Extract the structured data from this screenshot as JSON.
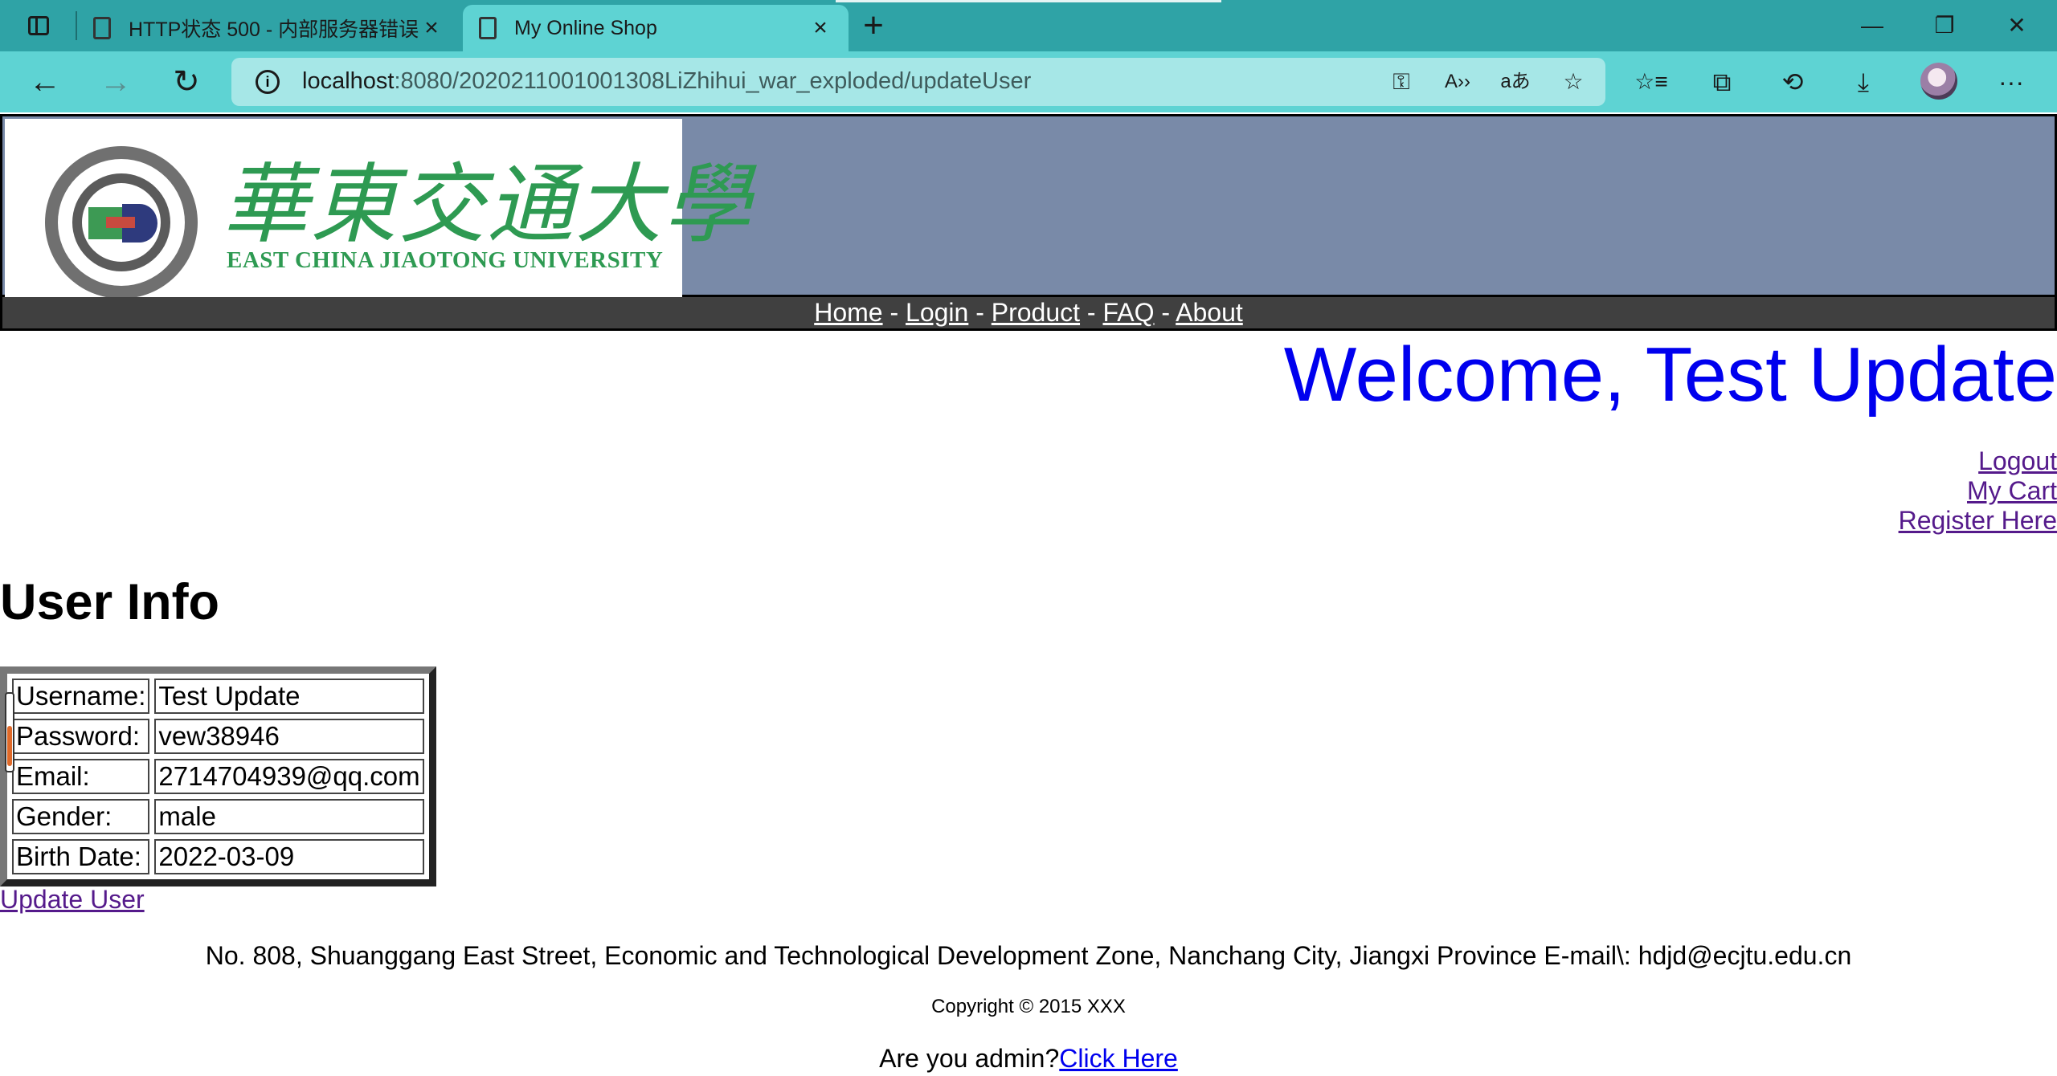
{
  "browser": {
    "tabs": [
      {
        "title": "HTTP状态 500 - 内部服务器错误",
        "active": false
      },
      {
        "title": "My Online Shop",
        "active": true
      }
    ],
    "new_tab": "+",
    "window_controls": {
      "minimize": "—",
      "restore": "❐",
      "close": "✕"
    },
    "nav": {
      "back": "←",
      "forward": "→",
      "refresh": "↻"
    },
    "address": {
      "host": "localhost",
      "rest": ":8080/2020211001001308LiZhihui_war_exploded/updateUser"
    },
    "address_icons": [
      "key-icon",
      "read-aloud-icon",
      "translate-icon",
      "add-favorite-icon"
    ],
    "toolbar_icons": [
      "favorites-icon",
      "collections-icon",
      "history-icon",
      "downloads-icon",
      "profile-avatar",
      "more-icon"
    ],
    "icon_glyphs": {
      "key": "⚿",
      "read_aloud": "A››",
      "translate": "aあ",
      "add_favorite": "☆",
      "favorites": "☆≡",
      "collections": "⧉",
      "history": "⟲",
      "downloads": "⤓",
      "more": "···",
      "info": "i"
    }
  },
  "site": {
    "university_cn": "華東交通大學",
    "university_en": "EAST CHINA JIAOTONG UNIVERSITY",
    "colors": {
      "banner": "#798aa8",
      "navbar": "#404040",
      "logo_green": "#2e9a52",
      "link": "#0000ee",
      "visited": "#551a8b"
    },
    "nav": {
      "items": [
        "Home",
        "Login",
        "Product",
        "FAQ",
        "About"
      ],
      "separator": " - "
    },
    "welcome": "Welcome, Test Update",
    "user_links": [
      "Logout",
      "My Cart",
      "Register Here"
    ],
    "section_title": "User Info",
    "user_info": [
      {
        "label": "Username:",
        "value": "Test Update"
      },
      {
        "label": "Password:",
        "value": "vew38946"
      },
      {
        "label": "Email:",
        "value": "2714704939@qq.com"
      },
      {
        "label": "Gender:",
        "value": "male"
      },
      {
        "label": "Birth Date:",
        "value": "2022-03-09"
      }
    ],
    "update_link": "Update User",
    "footer": {
      "address": "No. 808, Shuanggang East Street, Economic and Technological Development Zone, Nanchang City, Jiangxi Province E-mail\\: hdjd@ecjtu.edu.cn",
      "copyright": "Copyright © 2015 XXX",
      "admin_prompt": "Are you admin?",
      "admin_link": "Click Here"
    }
  }
}
